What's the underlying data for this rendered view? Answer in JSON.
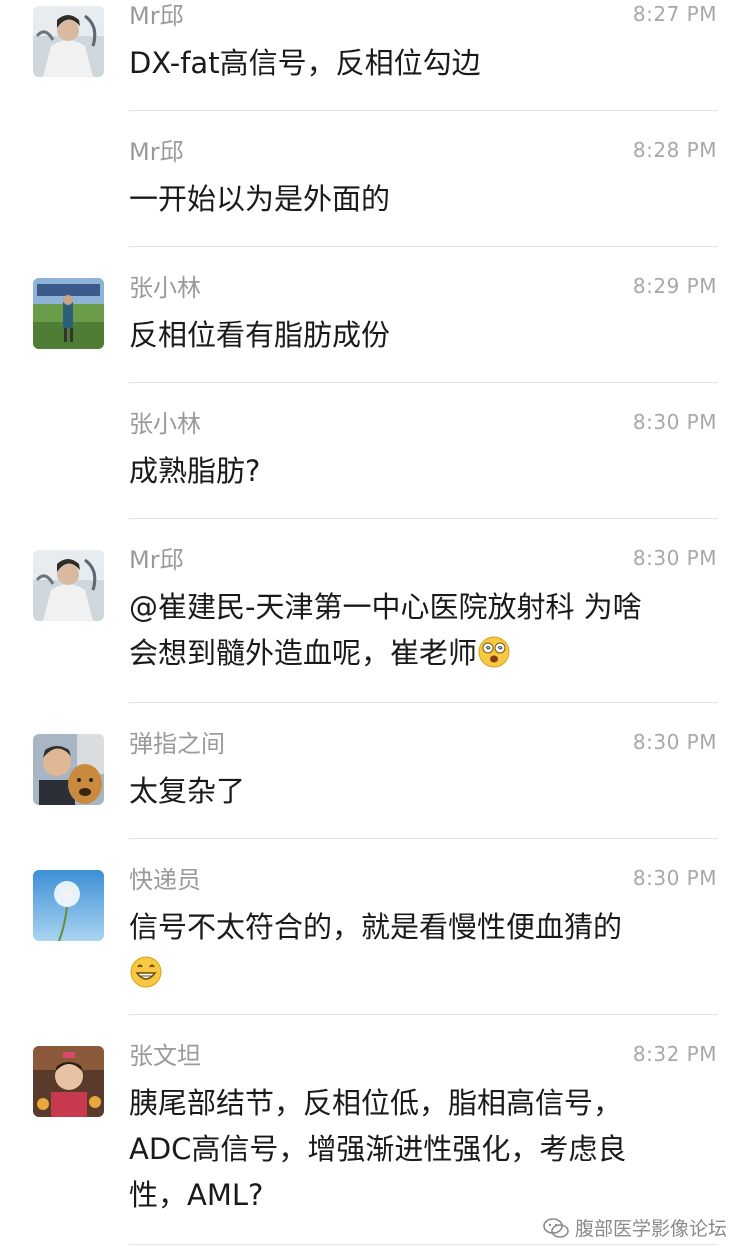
{
  "messages": [
    {
      "sender": "Mr邱",
      "time": "8:27 PM",
      "lines": [
        "DX-fat高信号，反相位勾边"
      ],
      "avatar": "avatar-man-photo"
    },
    {
      "sender": "Mr邱",
      "time": "8:28 PM",
      "lines": [
        "一开始以为是外面的"
      ],
      "avatar": ""
    },
    {
      "sender": "张小林",
      "time": "8:29 PM",
      "lines": [
        "反相位看有脂肪成份"
      ],
      "avatar": "avatar-landscape-photo"
    },
    {
      "sender": "张小林",
      "time": "8:30 PM",
      "lines": [
        "成熟脂肪?"
      ],
      "avatar": ""
    },
    {
      "sender": "Mr邱",
      "time": "8:30 PM",
      "lines": [
        "@崔建民-天津第一中心医院放射科 为啥",
        "会想到髓外造血呢，崔老师"
      ],
      "avatar": "avatar-man-photo"
    },
    {
      "sender": "弹指之间",
      "time": "8:30 PM",
      "lines": [
        "太复杂了"
      ],
      "avatar": "avatar-man-dog-photo"
    },
    {
      "sender": "快递员",
      "time": "8:30 PM",
      "lines": [
        "信号不太符合的，就是看慢性便血猜的"
      ],
      "avatar": "avatar-dandelion-photo"
    },
    {
      "sender": "张文坦",
      "time": "8:32 PM",
      "lines": [
        "胰尾部结节，反相位低，脂相高信号，",
        "ADC高信号，增强渐进性强化，考虑良",
        "性，AML?"
      ],
      "avatar": "avatar-child-photo"
    }
  ],
  "watermark": {
    "text": "腹部医学影像论坛"
  },
  "colors": {
    "sender": "#9a9a9a",
    "time": "#a8a8a8",
    "text": "#1a1a1a",
    "separator": "#e2e2e2"
  }
}
